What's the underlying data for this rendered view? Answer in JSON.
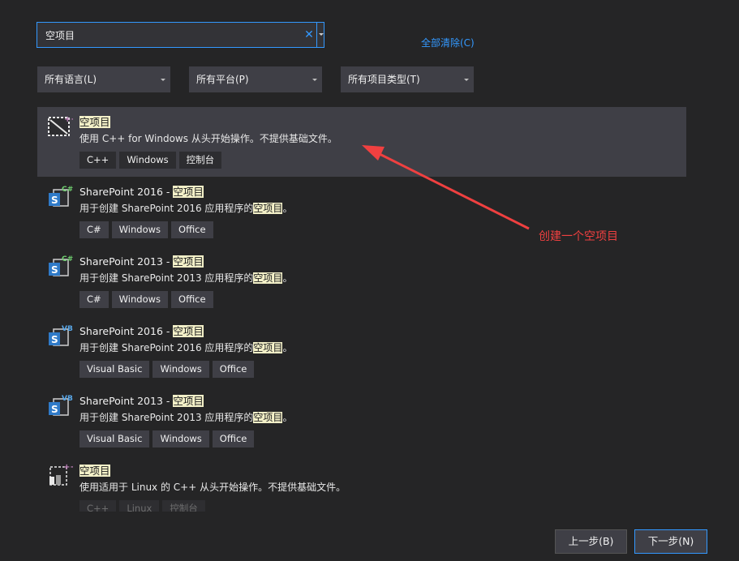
{
  "search": {
    "value": "空项目",
    "placeholder": ""
  },
  "clear_all": "全部清除(C)",
  "filters": [
    {
      "label": "所有语言(L)"
    },
    {
      "label": "所有平台(P)"
    },
    {
      "label": "所有项目类型(T)"
    }
  ],
  "templates": [
    {
      "title_pre": "",
      "title_hl": "空项目",
      "desc_pre": "使用 C++ for Windows 从头开始操作。不提供基础文件。",
      "desc_hl": "",
      "desc_post": "",
      "tags": [
        "C++",
        "Windows",
        "控制台"
      ],
      "icon": "cpp-empty-project-icon",
      "badge": "++"
    },
    {
      "title_pre": "SharePoint 2016 - ",
      "title_hl": "空项目",
      "desc_pre": "用于创建 SharePoint 2016 应用程序的",
      "desc_hl": "空项目",
      "desc_post": "。",
      "tags": [
        "C#",
        "Windows",
        "Office"
      ],
      "icon": "sharepoint-csharp-icon",
      "badge": "C#"
    },
    {
      "title_pre": "SharePoint 2013 - ",
      "title_hl": "空项目",
      "desc_pre": "用于创建 SharePoint 2013 应用程序的",
      "desc_hl": "空项目",
      "desc_post": "。",
      "tags": [
        "C#",
        "Windows",
        "Office"
      ],
      "icon": "sharepoint-csharp-icon",
      "badge": "C#"
    },
    {
      "title_pre": "SharePoint 2016 - ",
      "title_hl": "空项目",
      "desc_pre": "用于创建 SharePoint 2016 应用程序的",
      "desc_hl": "空项目",
      "desc_post": "。",
      "tags": [
        "Visual Basic",
        "Windows",
        "Office"
      ],
      "icon": "sharepoint-vb-icon",
      "badge": "VB"
    },
    {
      "title_pre": "SharePoint 2013 - ",
      "title_hl": "空项目",
      "desc_pre": "用于创建 SharePoint 2013 应用程序的",
      "desc_hl": "空项目",
      "desc_post": "。",
      "tags": [
        "Visual Basic",
        "Windows",
        "Office"
      ],
      "icon": "sharepoint-vb-icon",
      "badge": "VB"
    },
    {
      "title_pre": "",
      "title_hl": "空项目",
      "desc_pre": "使用适用于 Linux 的 C++ 从头开始操作。不提供基础文件。",
      "desc_hl": "",
      "desc_post": "",
      "tags": [
        "C++",
        "Linux",
        "控制台"
      ],
      "icon": "linux-cpp-project-icon",
      "badge": "++"
    }
  ],
  "annotation": "创建一个空项目",
  "buttons": {
    "back": "上一步(B)",
    "next": "下一步(N)"
  },
  "colors": {
    "accent": "#3399ff",
    "highlight": "#f3f0c8",
    "annotation": "#f04040",
    "background": "#252526"
  }
}
